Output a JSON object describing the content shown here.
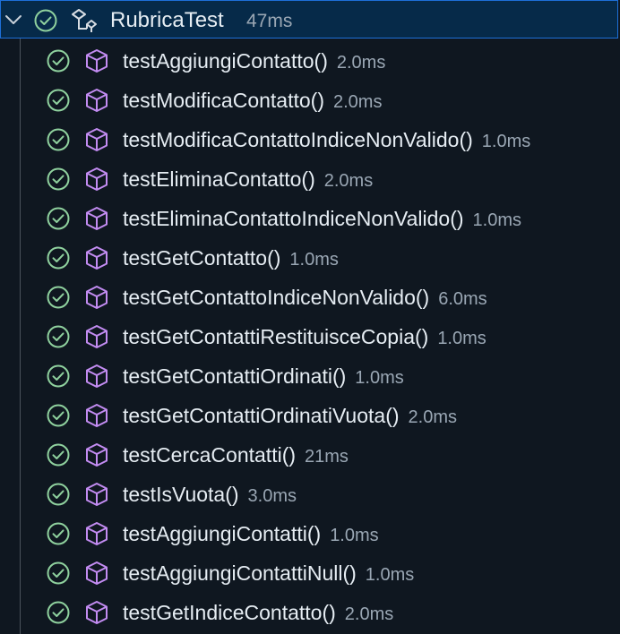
{
  "suite": {
    "name": "RubricaTest",
    "duration": "47ms",
    "expanded_icon": "chevron-down-icon",
    "status_icon": "passed-check-icon",
    "type_icon": "test-class-icon"
  },
  "colors": {
    "pass": "#8fd19e",
    "method_icon": "#c38cf2",
    "selection_bg": "#062a49",
    "selection_border": "#1d6fd8"
  },
  "tests": [
    {
      "name": "testAggiungiContatto()",
      "duration": "2.0ms"
    },
    {
      "name": "testModificaContatto()",
      "duration": "2.0ms"
    },
    {
      "name": "testModificaContattoIndiceNonValido()",
      "duration": "1.0ms"
    },
    {
      "name": "testEliminaContatto()",
      "duration": "2.0ms"
    },
    {
      "name": "testEliminaContattoIndiceNonValido()",
      "duration": "1.0ms"
    },
    {
      "name": "testGetContatto()",
      "duration": "1.0ms"
    },
    {
      "name": "testGetContattoIndiceNonValido()",
      "duration": "6.0ms"
    },
    {
      "name": "testGetContattiRestituisceCopia()",
      "duration": "1.0ms"
    },
    {
      "name": "testGetContattiOrdinati()",
      "duration": "1.0ms"
    },
    {
      "name": "testGetContattiOrdinatiVuota()",
      "duration": "2.0ms"
    },
    {
      "name": "testCercaContatti()",
      "duration": "21ms"
    },
    {
      "name": "testIsVuota()",
      "duration": "3.0ms"
    },
    {
      "name": "testAggiungiContatti()",
      "duration": "1.0ms"
    },
    {
      "name": "testAggiungiContattiNull()",
      "duration": "1.0ms"
    },
    {
      "name": "testGetIndiceContatto()",
      "duration": "2.0ms"
    }
  ]
}
